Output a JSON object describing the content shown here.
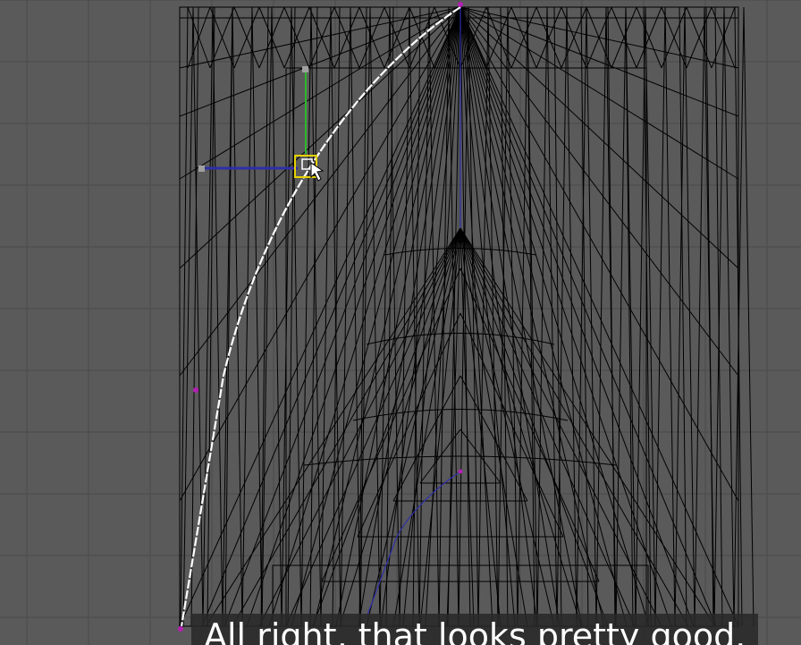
{
  "viewport": {
    "background": "#5a5a5a",
    "grid_color": "#4b4b4b",
    "wire_color": "#000000",
    "spline_color": "#ffffff",
    "axis_x_color": "#2f2fa8",
    "axis_y_color": "#2fb82f",
    "vertex_color": "#b21fb2",
    "selection_color": "#e6d200",
    "gizmo_handle_color": "#a0a0a0"
  },
  "caption": {
    "text": "All right, that looks pretty good."
  }
}
